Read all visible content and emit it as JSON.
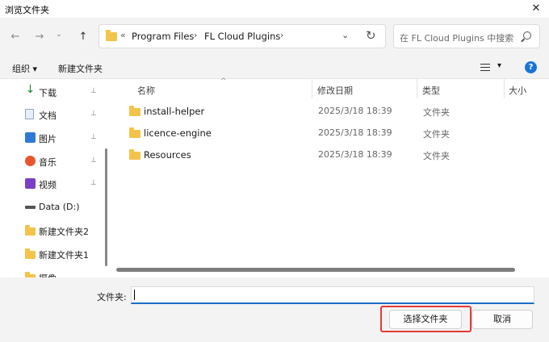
{
  "window": {
    "title": "浏览文件夹",
    "close_glyph": "✕"
  },
  "nav": {
    "back_glyph": "←",
    "forward_glyph": "→",
    "down_glyph": "⌄",
    "up_glyph": "↑",
    "breadcrumb_overflow": "«",
    "breadcrumbs": [
      "Program Files",
      "FL Cloud Plugins"
    ],
    "separator": "›",
    "dropdown_glyph": "⌄",
    "refresh_glyph": "↻",
    "search_placeholder": "在 FL Cloud Plugins 中搜索"
  },
  "toolbar": {
    "organize": "组织 ▾",
    "new_folder": "新建文件夹",
    "view_drop": "▾",
    "help": "?"
  },
  "sidebar": {
    "items": [
      {
        "label": "下载",
        "icon": "download-icon",
        "pinned": true
      },
      {
        "label": "文档",
        "icon": "document-icon",
        "pinned": true
      },
      {
        "label": "图片",
        "icon": "pictures-icon",
        "pinned": true
      },
      {
        "label": "音乐",
        "icon": "music-icon",
        "pinned": true
      },
      {
        "label": "视频",
        "icon": "video-icon",
        "pinned": true
      },
      {
        "label": "Data (D:)",
        "icon": "drive-icon",
        "pinned": false
      },
      {
        "label": "新建文件夹2",
        "icon": "folder-icon",
        "pinned": false
      },
      {
        "label": "新建文件夹1",
        "icon": "folder-icon",
        "pinned": false
      },
      {
        "label": "摄像",
        "icon": "folder-icon",
        "pinned": false
      }
    ],
    "pin_glyph": "📌"
  },
  "columns": {
    "name": "名称",
    "modified": "修改日期",
    "type": "类型",
    "size": "大小",
    "sort_glyph": "^"
  },
  "files": [
    {
      "name": "install-helper",
      "modified": "2025/3/18 18:39",
      "type": "文件夹"
    },
    {
      "name": "licence-engine",
      "modified": "2025/3/18 18:39",
      "type": "文件夹"
    },
    {
      "name": "Resources",
      "modified": "2025/3/18 18:39",
      "type": "文件夹"
    }
  ],
  "footer": {
    "folder_label": "文件夹:",
    "folder_value": "",
    "select_button": "选择文件夹",
    "cancel_button": "取消"
  },
  "colors": {
    "accent": "#1a6ec7",
    "highlight_box": "#e53935",
    "folder": "#f4c44a"
  }
}
